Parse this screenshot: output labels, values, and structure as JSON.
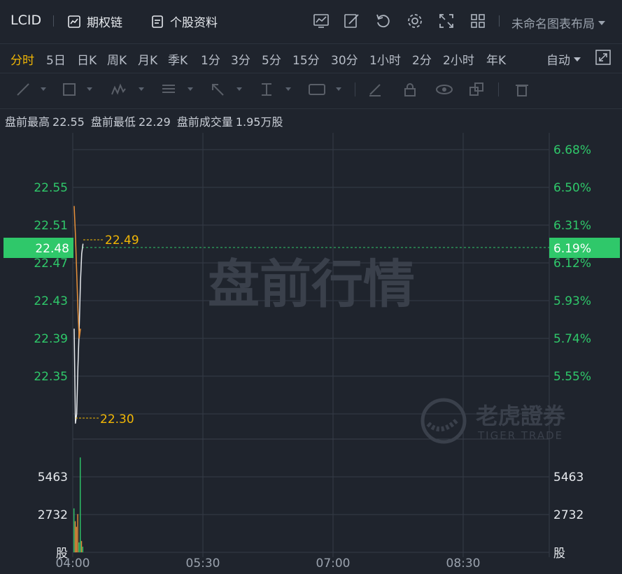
{
  "header": {
    "ticker": "LCID",
    "options_chain": "期权链",
    "profile": "个股资料",
    "layout": "未命名图表布局",
    "icons": [
      "chart-line-icon",
      "edit-icon",
      "refresh-icon",
      "gear-icon",
      "fullscreen-icon",
      "grid-icon"
    ]
  },
  "periods": [
    "分时",
    "5日",
    "日K",
    "周K",
    "月K",
    "季K",
    "1分",
    "3分",
    "5分",
    "15分",
    "30分",
    "1小时",
    "2分",
    "2小时",
    "年K"
  ],
  "active_period": "分时",
  "auto_label": "自动",
  "info": {
    "high_label": "盘前最高",
    "high": "22.55",
    "low_label": "盘前最低",
    "low": "22.29",
    "vol_label": "盘前成交量",
    "vol": "1.95万股"
  },
  "watermark": {
    "text": "盘前行情",
    "brand": "老虎證券",
    "brand_en": "TIGER TRADE"
  },
  "chart_data": {
    "type": "line",
    "x_ticks": [
      "04:00",
      "05:30",
      "07:00",
      "08:30"
    ],
    "price_ticks": [
      "22.55",
      "22.51",
      "22.47",
      "22.43",
      "22.39",
      "22.35"
    ],
    "pct_ticks": [
      "6.68%",
      "6.50%",
      "6.31%",
      "6.12%",
      "5.93%",
      "5.74%",
      "5.55%"
    ],
    "volume_ticks": [
      "5463",
      "2732"
    ],
    "volume_unit": "股",
    "current_price": "22.48",
    "current_pct": "6.19%",
    "max_marker": "22.49",
    "min_marker": "22.30",
    "ylim": [
      22.319,
      22.583
    ],
    "price_series": [
      {
        "name": "price",
        "color": "#e6e9ed",
        "x": [
          0,
          1,
          2,
          3,
          4,
          5,
          6,
          7
        ],
        "values": [
          22.4,
          22.3,
          22.31,
          22.36,
          22.4,
          22.45,
          22.48,
          22.49
        ]
      },
      {
        "name": "avg",
        "color": "#e8913a",
        "x": [
          0,
          1,
          2,
          3,
          4,
          5
        ],
        "values": [
          22.53,
          22.5,
          22.46,
          22.42,
          22.39,
          22.4
        ]
      }
    ],
    "volume_max": 8000,
    "volume_bars": [
      {
        "x": 0,
        "value": 3100,
        "color": "#2fc86a"
      },
      {
        "x": 1,
        "value": 2200,
        "color": "#e8913a"
      },
      {
        "x": 2,
        "value": 1800,
        "color": "#e8913a"
      },
      {
        "x": 3,
        "value": 2700,
        "color": "#e8913a"
      },
      {
        "x": 4,
        "value": 700,
        "color": "#2fc86a"
      },
      {
        "x": 5,
        "value": 6700,
        "color": "#2fc86a"
      },
      {
        "x": 6,
        "value": 800,
        "color": "#e8913a"
      },
      {
        "x": 7,
        "value": 400,
        "color": "#2fc86a"
      }
    ]
  }
}
